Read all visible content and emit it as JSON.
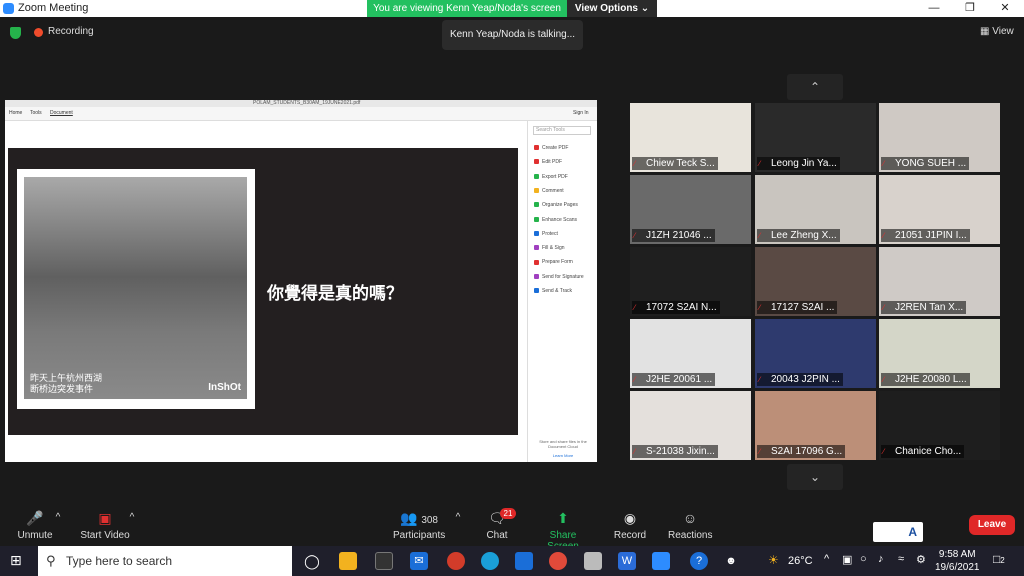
{
  "window": {
    "title": "Zoom Meeting"
  },
  "banner": {
    "text": "You are viewing Kenn Yeap/Noda's screen",
    "view_options": "View Options ⌄"
  },
  "talking": "Kenn Yeap/Noda is talking...",
  "topbar": {
    "recording": "Recording",
    "view": "View"
  },
  "pdf": {
    "filename": "POLAM_STUDENTS_B30AM_19JUNE2021.pdf",
    "tabs": [
      "Home",
      "Tools",
      "Document"
    ],
    "sign_in": "Sign In",
    "page_text": "你覺得是真的嗎？",
    "photo_caption": [
      "昨天上午杭州西湖",
      "断桥边突发事件"
    ],
    "photo_brand": "InShOt",
    "search_placeholder": "Search Tools",
    "tools": [
      "Create PDF",
      "Edit PDF",
      "Export PDF",
      "Comment",
      "Organize Pages",
      "Enhance Scans",
      "Protect",
      "Fill & Sign",
      "Prepare Form",
      "Send for Signature",
      "Send & Track"
    ],
    "cloud_note": "Store and share files in the Document Cloud",
    "learn_more": "Learn More"
  },
  "participants_tiles": [
    {
      "name": "Chiew Teck S...",
      "bg": "#e8e4dc"
    },
    {
      "name": "Leong Jin Ya...",
      "bg": "#2a2a2a"
    },
    {
      "name": "YONG SUEH ...",
      "bg": "#cfc9c4"
    },
    {
      "name": "J1ZH 21046 ...",
      "bg": "#6a6a6a"
    },
    {
      "name": "Lee Zheng X...",
      "bg": "#c9c5bf"
    },
    {
      "name": "21051 J1PIN I...",
      "bg": "#d8d2cc"
    },
    {
      "name": "17072 S2AI N...",
      "bg": "#1f1f1f"
    },
    {
      "name": "17127 S2AI ...",
      "bg": "#5a4a44"
    },
    {
      "name": "J2REN Tan X...",
      "bg": "#cfcac6"
    },
    {
      "name": "J2HE 20061 ...",
      "bg": "#e2e2e2"
    },
    {
      "name": "20043 J2PIN ...",
      "bg": "#2e3a6e"
    },
    {
      "name": "J2HE 20080 L...",
      "bg": "#d4d6c8"
    },
    {
      "name": "S-21038 Jixin...",
      "bg": "#e4e0dc"
    },
    {
      "name": "S2AI 17096 G...",
      "bg": "#bc8f78"
    },
    {
      "name": "Chanice Cho...",
      "bg": "#1e1e1e"
    }
  ],
  "toolbar": {
    "unmute": "Unmute",
    "start_video": "Start Video",
    "participants": "Participants",
    "participants_count": "308",
    "chat": "Chat",
    "chat_badge": "21",
    "share_screen": "Share Screen",
    "record": "Record",
    "reactions": "Reactions",
    "leave": "Leave"
  },
  "lang_indicator": "A",
  "taskbar": {
    "search": "Type here to search",
    "temperature": "26°C",
    "time": "9:58 AM",
    "date": "19/6/2021",
    "notifications": "2"
  },
  "colors": {
    "accent_green": "#23c060",
    "leave_red": "#e02828",
    "zoom_blue": "#2d8cff"
  }
}
